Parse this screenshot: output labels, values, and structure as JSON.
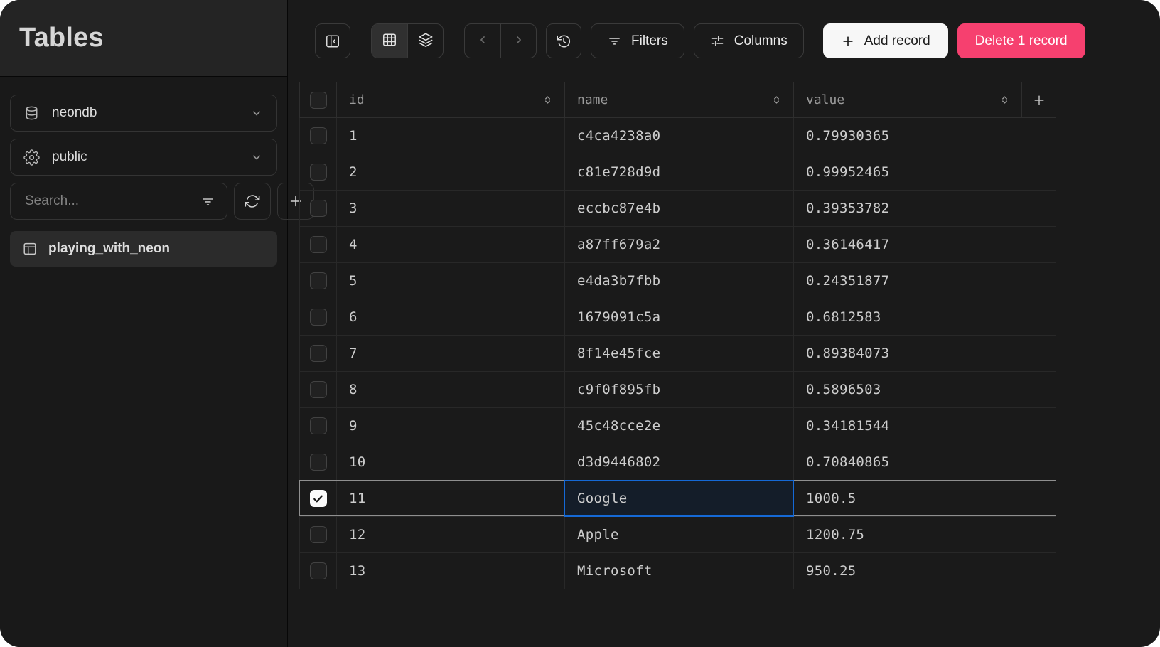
{
  "sidebar": {
    "title": "Tables",
    "database_select": {
      "label": "neondb",
      "icon": "database-icon"
    },
    "schema_select": {
      "label": "public",
      "icon": "schema-icon"
    },
    "search": {
      "placeholder": "Search...",
      "value": "",
      "icon": "filter-icon"
    },
    "actions": [
      {
        "name": "refresh",
        "icon": "refresh-icon"
      },
      {
        "name": "add-table",
        "icon": "plus-icon"
      }
    ],
    "tables": [
      {
        "label": "playing_with_neon",
        "icon": "table-icon",
        "selected": true
      }
    ]
  },
  "toolbar": {
    "collapse_sidebar_icon": "panel-collapse-icon",
    "view_switcher": [
      {
        "name": "table-view",
        "icon": "grid-icon",
        "active": true
      },
      {
        "name": "layers-view",
        "icon": "layers-icon",
        "active": false
      }
    ],
    "pagination": [
      {
        "name": "prev",
        "icon": "chevron-left-icon",
        "disabled": true
      },
      {
        "name": "next",
        "icon": "chevron-right-icon",
        "disabled": false
      }
    ],
    "history_icon": "history-icon",
    "filters_label": "Filters",
    "columns_label": "Columns",
    "add_record_label": "Add record",
    "delete_label": "Delete 1 record"
  },
  "table": {
    "columns": [
      {
        "key": "id",
        "label": "id",
        "sortable": true
      },
      {
        "key": "name",
        "label": "name",
        "sortable": true
      },
      {
        "key": "value",
        "label": "value",
        "sortable": true
      }
    ],
    "add_column_icon": "plus-icon",
    "rows": [
      {
        "id": "1",
        "name": "c4ca4238a0",
        "value": "0.79930365",
        "checked": false,
        "selected": false
      },
      {
        "id": "2",
        "name": "c81e728d9d",
        "value": "0.99952465",
        "checked": false,
        "selected": false
      },
      {
        "id": "3",
        "name": "eccbc87e4b",
        "value": "0.39353782",
        "checked": false,
        "selected": false
      },
      {
        "id": "4",
        "name": "a87ff679a2",
        "value": "0.36146417",
        "checked": false,
        "selected": false
      },
      {
        "id": "5",
        "name": "e4da3b7fbb",
        "value": "0.24351877",
        "checked": false,
        "selected": false
      },
      {
        "id": "6",
        "name": "1679091c5a",
        "value": "0.6812583",
        "checked": false,
        "selected": false
      },
      {
        "id": "7",
        "name": "8f14e45fce",
        "value": "0.89384073",
        "checked": false,
        "selected": false
      },
      {
        "id": "8",
        "name": "c9f0f895fb",
        "value": "0.5896503",
        "checked": false,
        "selected": false
      },
      {
        "id": "9",
        "name": "45c48cce2e",
        "value": "0.34181544",
        "checked": false,
        "selected": false
      },
      {
        "id": "10",
        "name": "d3d9446802",
        "value": "0.70840865",
        "checked": false,
        "selected": false
      },
      {
        "id": "11",
        "name": "Google",
        "value": "1000.5",
        "checked": true,
        "selected": true,
        "editing_column": "name"
      },
      {
        "id": "12",
        "name": "Apple",
        "value": "1200.75",
        "checked": false,
        "selected": false
      },
      {
        "id": "13",
        "name": "Microsoft",
        "value": "950.25",
        "checked": false,
        "selected": false
      }
    ]
  },
  "colors": {
    "accent_blue": "#1569d6",
    "editing_cell_bg": "#141d29",
    "danger_pink": "#f6406f",
    "selected_row_outline": "#8f8f8f",
    "checkbox_checked": "#fafafa"
  }
}
